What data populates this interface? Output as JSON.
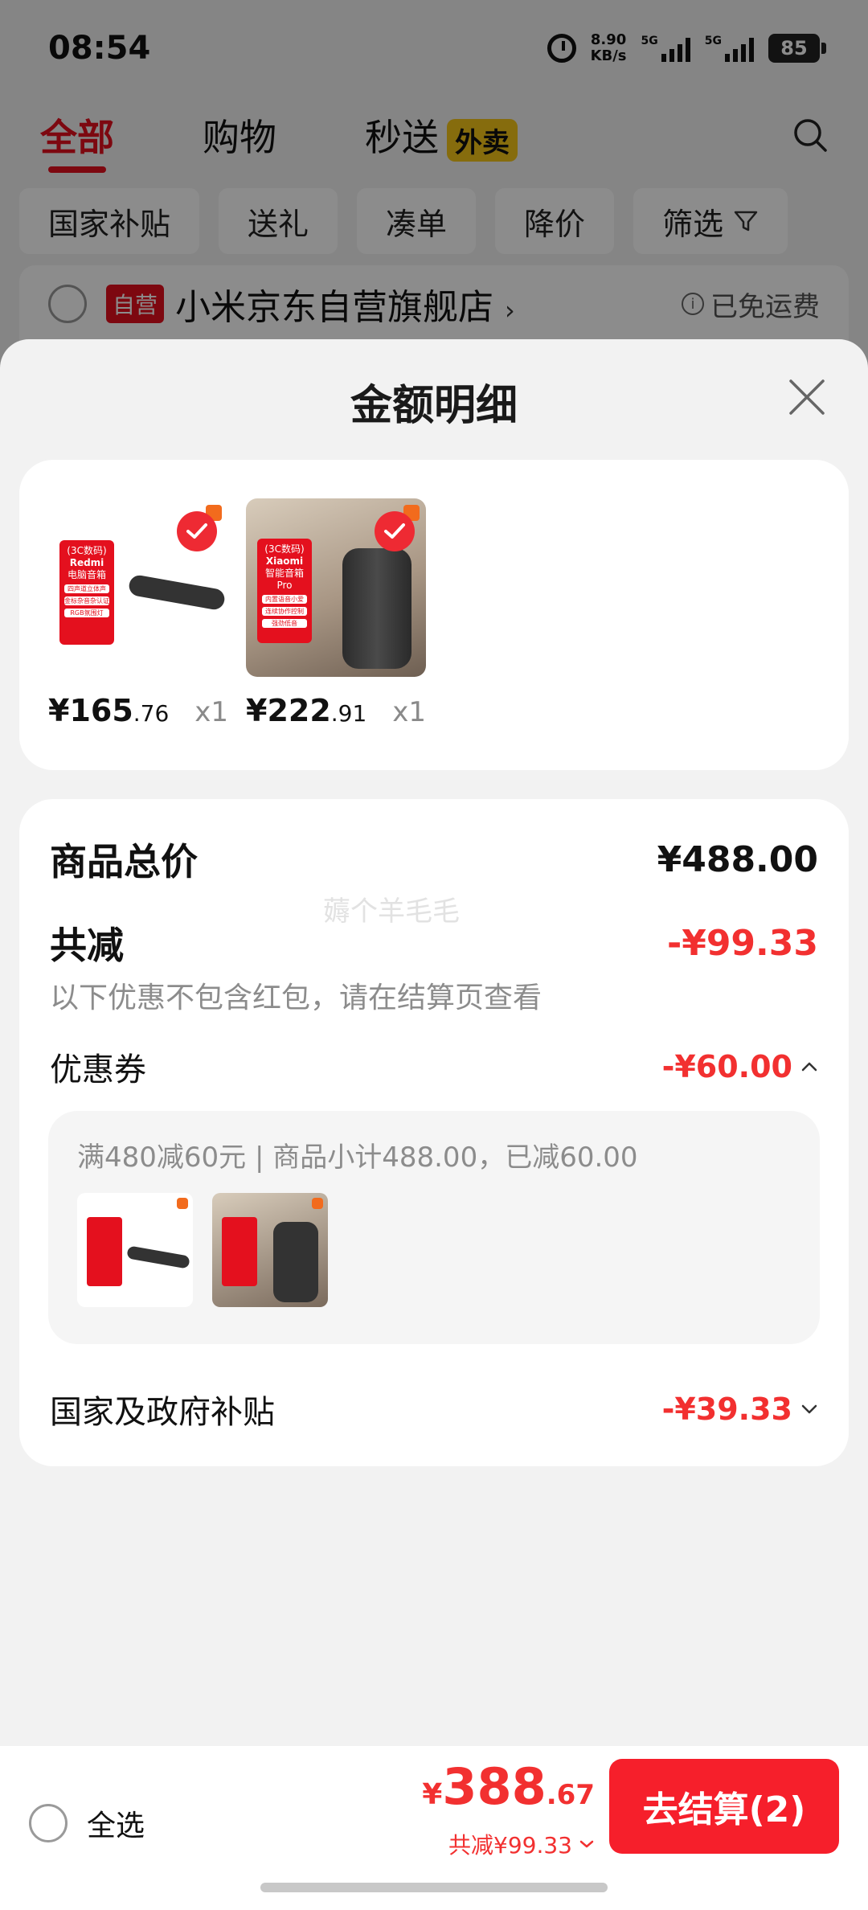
{
  "status_bar": {
    "time": "08:54",
    "speed_value": "8.90",
    "speed_unit": "KB/s",
    "net1": "5G",
    "net2": "5G",
    "battery": "85"
  },
  "top_tabs": [
    {
      "label": "全部",
      "active": true
    },
    {
      "label": "购物",
      "active": false
    },
    {
      "label": "秒送",
      "active": false,
      "badge": "外卖"
    }
  ],
  "filters": [
    "国家补贴",
    "送礼",
    "凑单",
    "降价",
    "筛选"
  ],
  "store": {
    "tag": "自营",
    "name": "小米京东自营旗舰店",
    "chevron": "›",
    "shipping": "已免运费"
  },
  "sheet": {
    "title": "金额明细",
    "watermark": "薅个羊毛毛",
    "products": [
      {
        "price_int": "¥165",
        "price_dec": ".76",
        "qty": "x1",
        "img_text": [
          "(3C数码)",
          "Redmi",
          "电脑音箱"
        ],
        "img_pills": [
          "四声道立体声",
          "金标杂音杂认证",
          "RGB氛围灯"
        ]
      },
      {
        "price_int": "¥222",
        "price_dec": ".91",
        "qty": "x1",
        "img_text": [
          "(3C数码)",
          "Xiaomi",
          "智能音箱 Pro"
        ],
        "img_pills": [
          "内置语音小爱",
          "连续协作控制",
          "强劲低音"
        ]
      }
    ],
    "total_label": "商品总价",
    "total_value": "¥488.00",
    "discount_label": "共减",
    "discount_value": "-¥99.33",
    "discount_note": "以下优惠不包含红包，请在结算页查看",
    "coupon_label": "优惠券",
    "coupon_value": "-¥60.00",
    "coupon_detail": "满480减60元 | 商品小计488.00，已减60.00",
    "subsidy_label": "国家及政府补贴",
    "subsidy_value": "-¥39.33"
  },
  "bottom_bar": {
    "select_all": "全选",
    "price_currency": "¥",
    "price_int": "388",
    "price_dec": ".67",
    "discount_line": "共减¥99.33",
    "checkout_label": "去结算(2)"
  },
  "colors": {
    "accent_red": "#e4101e",
    "price_red": "#f23030",
    "checkout_red": "#f61f2b"
  }
}
